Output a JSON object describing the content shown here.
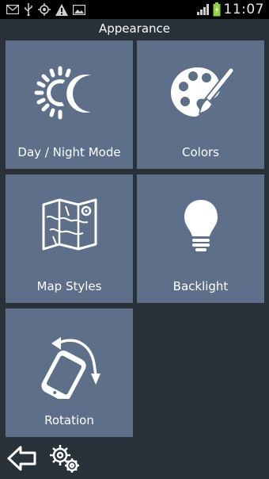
{
  "status_bar": {
    "time": "11:07",
    "left_icons": [
      "mail-icon",
      "usb-icon",
      "gps-icon",
      "warning-icon",
      "image-icon"
    ],
    "right_icons": [
      "signal-icon",
      "battery-icon"
    ]
  },
  "header": {
    "title": "Appearance"
  },
  "tiles": [
    {
      "label": "Day / Night Mode",
      "icon": "day-night-icon"
    },
    {
      "label": "Colors",
      "icon": "palette-icon"
    },
    {
      "label": "Map Styles",
      "icon": "map-icon"
    },
    {
      "label": "Backlight",
      "icon": "lightbulb-icon"
    },
    {
      "label": "Rotation",
      "icon": "rotation-icon"
    }
  ],
  "bottom_bar": {
    "icons": [
      "back-arrow-icon",
      "settings-gears-icon"
    ]
  },
  "colors": {
    "background": "#2a3239",
    "tile": "#5d6f89",
    "status_bar": "#000000"
  }
}
